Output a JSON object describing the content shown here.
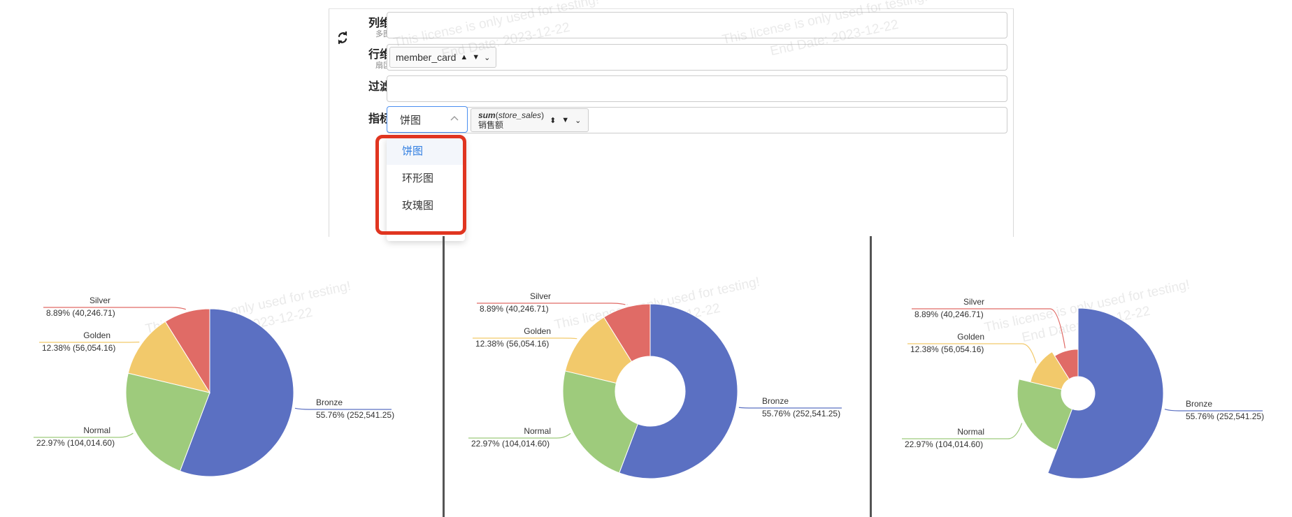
{
  "config_panel": {
    "rows": [
      {
        "label": "列维",
        "sublabel": "多图"
      },
      {
        "label": "行维",
        "sublabel": "扇区"
      },
      {
        "label": "过滤",
        "sublabel": ""
      },
      {
        "label": "指标",
        "sublabel": ""
      }
    ],
    "row_field": "member_card",
    "chart_type_selected": "饼图",
    "metric_fn": "sum",
    "metric_field": "store_sales",
    "metric_alias": "销售额",
    "dropdown_options": [
      "饼图",
      "环形图",
      "玫瑰图"
    ]
  },
  "watermark": {
    "line1": "This license is only used for testing!",
    "line2": "End Date: 2023-12-22"
  },
  "colors": {
    "bronze": "#5b70c2",
    "normal": "#9ecb7c",
    "golden": "#f2c96b",
    "silver": "#e06b66",
    "accent": "#2f7de1",
    "highlight": "#e03520"
  },
  "chart_data": [
    {
      "type": "pie",
      "categories": [
        "Bronze",
        "Normal",
        "Golden",
        "Silver"
      ],
      "values": [
        252541.25,
        104014.6,
        56054.16,
        40246.71
      ],
      "labels": [
        "55.76% (252,541.25)",
        "22.97% (104,014.60)",
        "12.38% (56,054.16)",
        "8.89% (40,246.71)"
      ]
    },
    {
      "type": "pie",
      "variant": "donut",
      "categories": [
        "Bronze",
        "Normal",
        "Golden",
        "Silver"
      ],
      "values": [
        252541.25,
        104014.6,
        56054.16,
        40246.71
      ],
      "labels": [
        "55.76% (252,541.25)",
        "22.97% (104,014.60)",
        "12.38% (56,054.16)",
        "8.89% (40,246.71)"
      ]
    },
    {
      "type": "pie",
      "variant": "rose",
      "categories": [
        "Bronze",
        "Normal",
        "Golden",
        "Silver"
      ],
      "values": [
        252541.25,
        104014.6,
        56054.16,
        40246.71
      ],
      "labels": [
        "55.76% (252,541.25)",
        "22.97% (104,014.60)",
        "12.38% (56,054.16)",
        "8.89% (40,246.71)"
      ]
    }
  ]
}
